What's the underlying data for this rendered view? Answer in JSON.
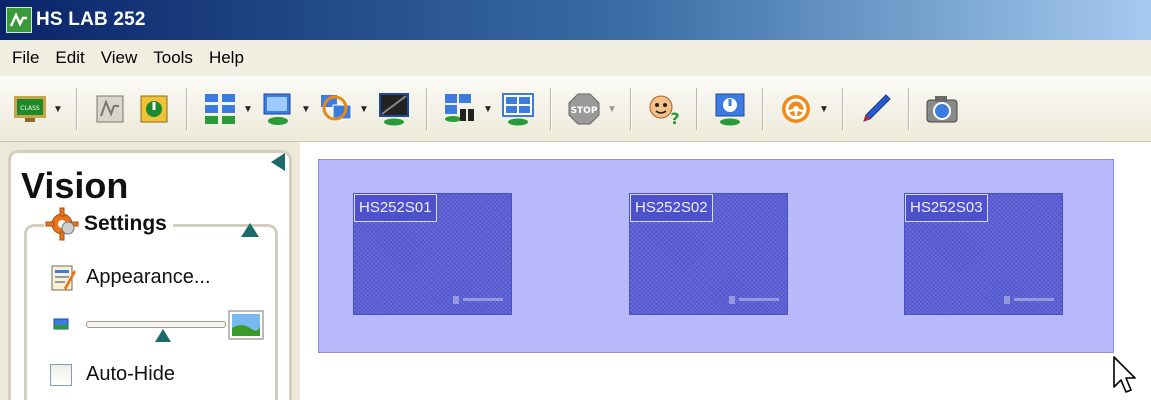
{
  "window": {
    "title": "HS LAB 252"
  },
  "menu": [
    "File",
    "Edit",
    "View",
    "Tools",
    "Help"
  ],
  "toolbar": {
    "stop_label": "STOP",
    "class_label": "CLASS"
  },
  "panel": {
    "title": "Vision",
    "settings": {
      "label": "Settings",
      "appearance_label": "Appearance...",
      "autohide_label": "Auto-Hide",
      "autohide_checked": false,
      "thumbnail_size": 0.55
    }
  },
  "workstations": [
    {
      "name": "HS252S01"
    },
    {
      "name": "HS252S02"
    },
    {
      "name": "HS252S03"
    }
  ],
  "colors": {
    "selection": "#b8b9fb",
    "thumbnail": "#5a5fd8",
    "accent": "#1c6a6a"
  }
}
